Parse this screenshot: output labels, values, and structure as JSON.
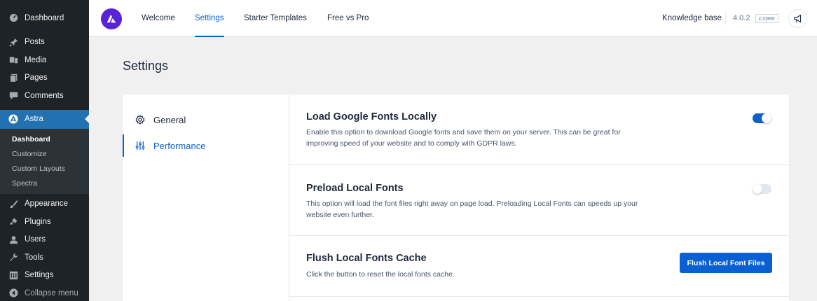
{
  "sidebar": {
    "items": [
      {
        "label": "Dashboard",
        "icon": "dashboard-icon"
      },
      {
        "label": "Posts",
        "icon": "pushpin-icon"
      },
      {
        "label": "Media",
        "icon": "media-icon"
      },
      {
        "label": "Pages",
        "icon": "pages-icon"
      },
      {
        "label": "Comments",
        "icon": "comment-icon"
      },
      {
        "label": "Astra",
        "icon": "astra-icon"
      }
    ],
    "submenu": [
      "Dashboard",
      "Customize",
      "Custom Layouts",
      "Spectra"
    ],
    "lower_items": [
      {
        "label": "Appearance",
        "icon": "brush-icon"
      },
      {
        "label": "Plugins",
        "icon": "plugin-icon"
      },
      {
        "label": "Users",
        "icon": "users-icon"
      },
      {
        "label": "Tools",
        "icon": "wrench-icon"
      },
      {
        "label": "Settings",
        "icon": "settings-icon"
      }
    ],
    "collapse_label": "Collapse menu"
  },
  "topbar": {
    "tabs": [
      "Welcome",
      "Settings",
      "Starter Templates",
      "Free vs Pro"
    ],
    "active_tab": "Settings",
    "knowledge_base": "Knowledge base",
    "version": "4.0.2",
    "badge": "CORE"
  },
  "page": {
    "title": "Settings",
    "subnav": [
      {
        "label": "General",
        "icon": "gear-icon"
      },
      {
        "label": "Performance",
        "icon": "sliders-icon"
      }
    ],
    "active_subnav": "Performance",
    "settings": [
      {
        "title": "Load Google Fonts Locally",
        "description": "Enable this option to download Google fonts and save them on your server. This can be great for improving speed of your website and to comply with GDPR laws.",
        "toggle_on": true
      },
      {
        "title": "Preload Local Fonts",
        "description": "This option will load the font files right away on page load. Preloading Local Fonts can speeds up your website even further.",
        "toggle_on": false
      },
      {
        "title": "Flush Local Fonts Cache",
        "description": "Click the button to reset the local fonts cache.",
        "button_label": "Flush Local Font Files"
      }
    ]
  },
  "colors": {
    "accent": "#0b60d1",
    "wp_sidebar": "#1d2327",
    "wp_active": "#2271b1",
    "astra_brand": "#5a22d6"
  }
}
